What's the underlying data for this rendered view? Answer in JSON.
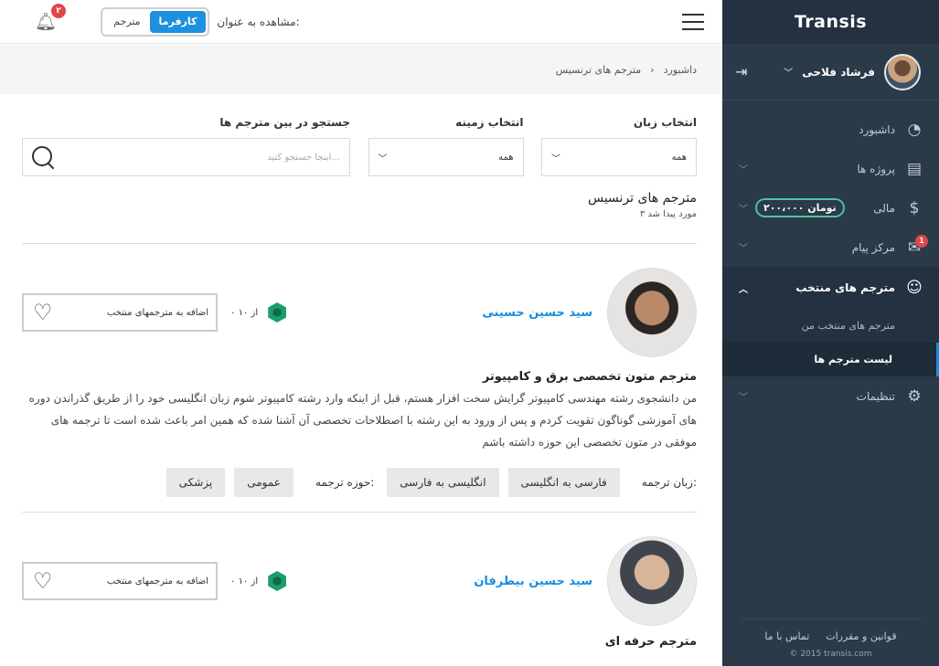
{
  "topbar": {
    "notifications_count": "۲",
    "role_label": "مشاهده به عنوان:",
    "role_options": [
      "کارفرما",
      "مترجم"
    ]
  },
  "breadcrumb": {
    "home": "داشبورد",
    "separator": "›",
    "current": "مترجم های ترنسیس"
  },
  "sidebar": {
    "brand": "Transis",
    "user_name": "فرشاد فلاحی",
    "items": [
      {
        "label": "داشبورد",
        "icon": "speedometer-icon"
      },
      {
        "label": "پروژه ها",
        "icon": "document-icon"
      },
      {
        "label": "مالی",
        "icon": "money-bag-icon",
        "badge": "۲۰۰،۰۰۰ تومان"
      },
      {
        "label": "مرکز پیام",
        "icon": "chat-icon",
        "badge": "1"
      },
      {
        "label": "مترجم های منتخب",
        "icon": "users-check-icon"
      },
      {
        "label": "تنظیمات",
        "icon": "gear-icon"
      }
    ],
    "subitems": [
      "مترجم های منتخب من",
      "لیست مترجم ها"
    ],
    "footer_links": [
      "تماس با ما",
      "قوانین و مقررات"
    ],
    "copyright": "© 2015 transis.com"
  },
  "filters": {
    "language_label": "انتخاب زبان",
    "language_value": "همه",
    "field_label": "انتخاب زمینه",
    "field_value": "همه",
    "search_label": "جستجو در بین مترجم ها",
    "search_placeholder": "اینجا جستجو کنید..."
  },
  "results": {
    "title": "مترجم های ترنسیس",
    "count": "۳ مورد پیدا شد"
  },
  "translators": [
    {
      "name": "سید حسین حسینی",
      "rating": "۰ از ۱۰",
      "add_favorite": "اضافه به مترجمهای منتخب",
      "specialty": "مترجم متون تخصصی برق و کامپیوتر",
      "bio": "من دانشجوی رشته مهندسی کامپیوتر گرایش سخت افزار هستم، قبل از اینکه وارد رشته کامپیوتر شوم زبان انگلیسی خود را از طریق گذراندن دوره های آموزشی گوناگون تقویت کردم و پس از ورود به این رشته با اصطلاحات تخصصی آن آشنا شده که همین امر باعث شده است تا ترجمه های موفقی در متون تخصصی این حوزه داشته باشم",
      "languages_label": "زبان ترجمه:",
      "languages": [
        "فارسی به انگلیسی",
        "انگلیسی به فارسی"
      ],
      "fields_label": "حوزه ترجمه:",
      "fields": [
        "عمومی",
        "پزشکی"
      ]
    },
    {
      "name": "سید حسین بیطرفان",
      "rating": "۰ از ۱۰",
      "add_favorite": "اضافه به مترجمهای منتخب",
      "specialty": "مترجم حرفه ای"
    }
  ]
}
